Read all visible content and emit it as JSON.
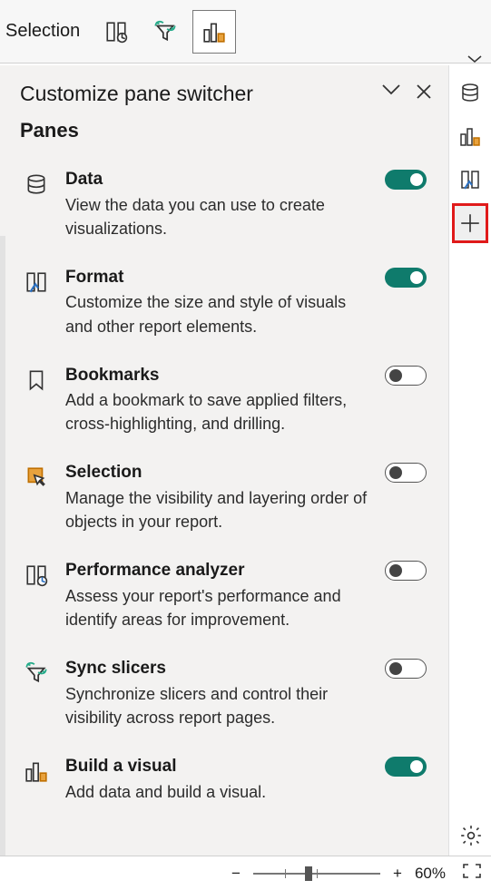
{
  "topbar": {
    "label": "Selection"
  },
  "panel": {
    "title": "Customize pane switcher",
    "subtitle": "Panes"
  },
  "panes": [
    {
      "name": "Data",
      "desc": "View the data you can use to create visualizations.",
      "on": true
    },
    {
      "name": "Format",
      "desc": "Customize the size and style of visuals and other report elements.",
      "on": true
    },
    {
      "name": "Bookmarks",
      "desc": "Add a bookmark to save applied filters, cross-highlighting, and drilling.",
      "on": false
    },
    {
      "name": "Selection",
      "desc": "Manage the visibility and layering order of objects in your report.",
      "on": false
    },
    {
      "name": "Performance analyzer",
      "desc": "Assess your report's performance and identify areas for improvement.",
      "on": false
    },
    {
      "name": "Sync slicers",
      "desc": "Synchronize slicers and control their visibility across report pages.",
      "on": false
    },
    {
      "name": "Build a visual",
      "desc": "Add data and build a visual.",
      "on": true
    }
  ],
  "status": {
    "minus": "−",
    "plus": "+",
    "zoom": "60%"
  }
}
